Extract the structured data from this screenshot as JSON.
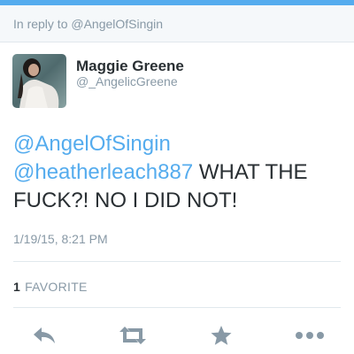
{
  "reply_header": {
    "text": "In reply to @AngelOfSingin"
  },
  "author": {
    "name": "Maggie Greene",
    "handle": "@_AngelicGreene"
  },
  "tweet": {
    "mention1": "@AngelOfSingin",
    "mention2": "@heatherleach887",
    "body": " WHAT THE FUCK?! NO I DID NOT!"
  },
  "timestamp": "1/19/15, 8:21 PM",
  "stats": {
    "favorite_count": "1",
    "favorite_label": "FAVORITE"
  },
  "actions": [
    {
      "icon": "reply-icon"
    },
    {
      "icon": "retweet-icon"
    },
    {
      "icon": "star-icon"
    },
    {
      "icon": "more-icon"
    }
  ],
  "colors": {
    "accent": "#55acee",
    "muted": "#8899a6",
    "text": "#292f33",
    "border": "#e1e8ed"
  }
}
